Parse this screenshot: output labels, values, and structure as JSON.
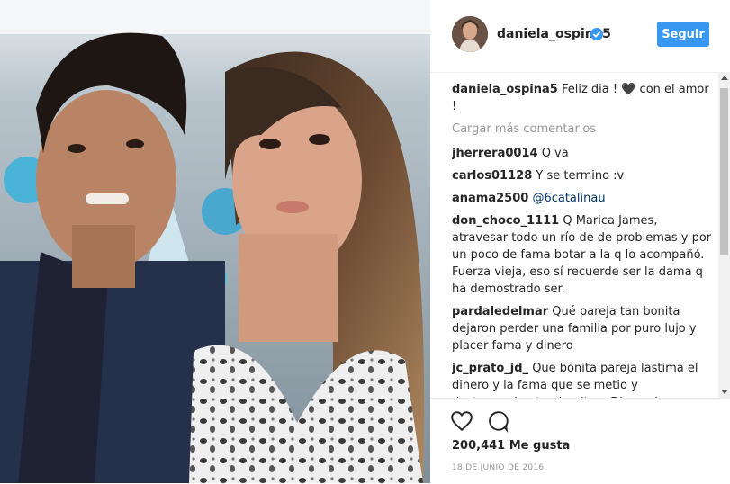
{
  "post": {
    "username": "daniela_ospina5",
    "follow_label": "Seguir",
    "caption_user": "daniela_ospina5",
    "caption_text": "Feliz dia ! 🖤 con el amor !",
    "load_more": "Cargar más comentarios",
    "comments": [
      {
        "user": "jherrera0014",
        "text": "Q va"
      },
      {
        "user": "carlos01128",
        "text": "Y se termino :v"
      },
      {
        "user": "anama2500",
        "text": "@6catalinau"
      },
      {
        "user": "don_choco_1111",
        "text": "Q Marica James, atravesar todo un río de de problemas y por un poco de fama botar a la q lo acompañó. Fuerza vieja, eso sí recuerde ser la dama q ha demostrado ser."
      },
      {
        "user": "pardaledelmar",
        "text": "Qué pareja tan bonita dejaron perder una familia por puro lujo y placer fama y dinero"
      },
      {
        "user": "jc_prato_jd_",
        "text": "Que bonita pareja lastima el dinero y la fama que se metio y destruyo.algo tan bonito .. Dios quiera y regresen en un futuro bendiciones para"
      }
    ],
    "likes": "200,441 Me gusta",
    "date": "18 DE JUNIO DE 2016"
  },
  "colors": {
    "accent": "#3897f0",
    "text": "#262626",
    "muted": "#999999",
    "mention": "#003569"
  },
  "icons": {
    "like": "heart-outline-icon",
    "comment": "speech-bubble-icon",
    "verified": "verified-badge-icon"
  }
}
